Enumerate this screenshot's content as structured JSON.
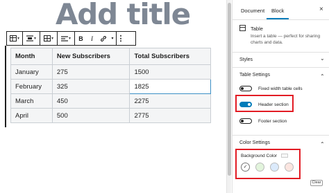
{
  "editor": {
    "post_title": "Add title",
    "toolbar": {
      "table_icon": "table-icon",
      "align_icon": "align-center-icon",
      "edit_table_icon": "table-edit-icon",
      "text_align_icon": "text-align-left-icon",
      "bold": "B",
      "italic": "I",
      "link_icon": "link-icon",
      "more_caret": "▾",
      "options": "⋮"
    },
    "table": {
      "headers": [
        "Month",
        "New Subscribers",
        "Total Subscribers"
      ],
      "rows": [
        [
          "January",
          "275",
          "1500"
        ],
        [
          "February",
          "325",
          "1825"
        ],
        [
          "March",
          "450",
          "2275"
        ],
        [
          "April",
          "500",
          "2775"
        ]
      ]
    }
  },
  "sidebar": {
    "tabs": [
      "Document",
      "Block"
    ],
    "active_tab": "Block",
    "close": "×",
    "block": {
      "name": "Table",
      "description": "Insert a table — perfect for sharing charts and data."
    },
    "styles_title": "Styles",
    "table_settings": {
      "title": "Table Settings",
      "toggles": [
        {
          "label": "Fixed width table cells",
          "on": false
        },
        {
          "label": "Header section",
          "on": true
        },
        {
          "label": "Footer section",
          "on": false
        }
      ]
    },
    "color_settings": {
      "title": "Color Settings",
      "background_label": "Background Color",
      "swatches": [
        "#ffffff",
        "#e2f4dc",
        "#dbeafb",
        "#fbe5e0"
      ],
      "selected_mark": "✓",
      "clear_label": "Clear"
    },
    "chevrons": {
      "down": "⌄",
      "up": "⌃"
    }
  },
  "highlight_color": "#e21b24",
  "accent": "#007cba"
}
